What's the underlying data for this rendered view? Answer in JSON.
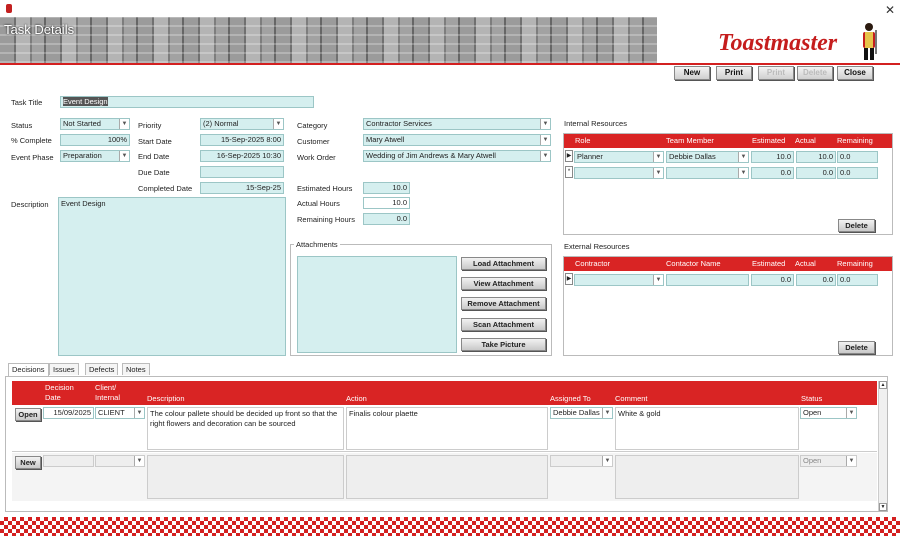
{
  "window": {
    "title": "Task Details",
    "brand": "Toastmaster"
  },
  "toolbar": {
    "new": "New",
    "print": "Print",
    "btn3": "Print",
    "btn4": "Delete",
    "close": "Close"
  },
  "task": {
    "title_label": "Task Title",
    "title": "Event Design",
    "status_label": "Status",
    "status": "Not Started",
    "complete_label": "% Complete",
    "complete": "100%",
    "phase_label": "Event Phase",
    "phase": "Preparation",
    "priority_label": "Priority",
    "priority": "(2) Normal",
    "start_label": "Start Date",
    "start": "15-Sep-2025 8:00",
    "end_label": "End Date",
    "end": "16-Sep-2025 10:30",
    "due_label": "Due Date",
    "due": "",
    "completed_label": "Completed Date",
    "completed": "15-Sep-25",
    "category_label": "Category",
    "category": "Contractor Services",
    "customer_label": "Customer",
    "customer": "Mary Atwell",
    "workorder_label": "Work Order",
    "workorder": "Wedding of Jim Andrews & Mary Atwell",
    "est_label": "Estimated Hours",
    "est": "10.0",
    "actual_label": "Actual Hours",
    "actual": "10.0",
    "remaining_label": "Remaining Hours",
    "remaining": "0.0",
    "desc_label": "Description",
    "description": "Event Design"
  },
  "attachments": {
    "label": "Attachments",
    "load": "Load Attachment",
    "view": "View Attachment",
    "remove": "Remove Attachment",
    "scan": "Scan Attachment",
    "picture": "Take Picture"
  },
  "internal": {
    "label": "Internal Resources",
    "headers": [
      "Role",
      "Team Member",
      "Estimated",
      "Actual",
      "Remaining"
    ],
    "rows": [
      {
        "role": "Planner",
        "member": "Debbie Dallas",
        "est": "10.0",
        "actual": "10.0",
        "remaining": "0.0"
      },
      {
        "role": "",
        "member": "",
        "est": "0.0",
        "actual": "0.0",
        "remaining": "0.0"
      }
    ],
    "delete": "Delete"
  },
  "external": {
    "label": "External Resources",
    "headers": [
      "Contractor",
      "Contactor Name",
      "Estimated",
      "Actual",
      "Remaining"
    ],
    "rows": [
      {
        "contractor": "",
        "name": "",
        "est": "0.0",
        "actual": "0.0",
        "remaining": "0.0"
      }
    ],
    "delete": "Delete"
  },
  "tabs": [
    "Decisions",
    "Issues",
    "Defects",
    "Notes"
  ],
  "decisions": {
    "headers": {
      "date1": "Decision",
      "date2": "Date",
      "client1": "Client/",
      "client2": "Internal",
      "description": "Description",
      "action": "Action",
      "assigned": "Assigned To",
      "comment": "Comment",
      "status": "Status"
    },
    "rows": [
      {
        "button": "Open",
        "date": "15/09/2025",
        "client": "CLIENT",
        "description": "The colour pallete should be decided up front so that the right flowers and decoration can be sourced",
        "action": "Finalis colour plaette",
        "assigned": "Debbie Dallas",
        "comment": "White & gold",
        "status": "Open"
      },
      {
        "button": "New",
        "date": "",
        "client": "",
        "description": "",
        "action": "",
        "assigned": "",
        "comment": "",
        "status": "Open"
      }
    ]
  },
  "colors": {
    "accent": "#d92424",
    "field": "#d5efef"
  }
}
